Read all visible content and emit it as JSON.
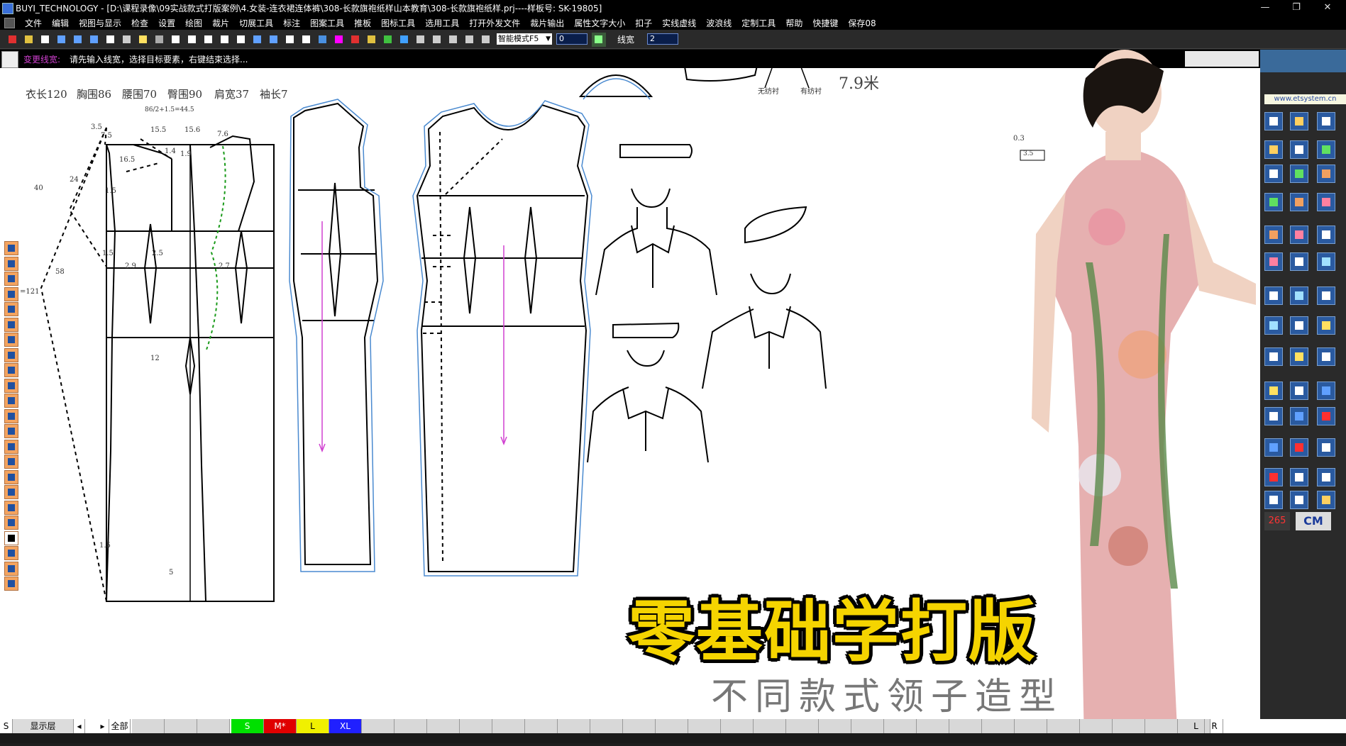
{
  "window": {
    "title": "BUYI_TECHNOLOGY - [D:\\课程录像\\09实战款式打版案例\\4.女装-连衣裙连体裤\\308-长款旗袍纸样山本教育\\308-长款旗袍纸样.prj----样板号: SK-19805]",
    "controls": [
      "—",
      "❐",
      "✕"
    ]
  },
  "menu": [
    "文件",
    "编辑",
    "视图与显示",
    "检查",
    "设置",
    "绘图",
    "裁片",
    "切展工具",
    "标注",
    "图案工具",
    "推板",
    "图标工具",
    "选用工具",
    "打开外发文件",
    "裁片输出",
    "属性文字大小",
    "扣子",
    "实线虚线",
    "波浪线",
    "定制工具",
    "帮助",
    "快捷键",
    "保存08"
  ],
  "toolbar": {
    "mode_select": "智能模式F5",
    "value_input": "0",
    "line_width_label": "线宽",
    "line_width_input": "2",
    "settings_label": "设"
  },
  "prompt": {
    "label": "变更线宽:",
    "text": "请先输入线宽，选择目标要素，右键结束选择..."
  },
  "measurements": {
    "length": "衣长120",
    "bust": "胸围86",
    "waist": "腰围70",
    "hip": "臀围90",
    "shoulder": "肩宽37",
    "sleeve": "袖长7",
    "formula": "86/2+1.5=44.5",
    "fabric": "7.9米"
  },
  "pattern_labels": {
    "a1": "3.5",
    "a2": "7.5",
    "a3": "15.5",
    "a4": "15.6",
    "a5": "7.6",
    "a6": "1.4",
    "a7": "1.9",
    "a8": "16.5",
    "a9": "40",
    "a10": "24",
    "a11": "1.5",
    "a12": "58",
    "a13": "=121",
    "a14": "1.5",
    "a15": "2.5",
    "a16": "2.9",
    "a17": "2.7",
    "a18": "12",
    "a19": "1.5",
    "a20": "5",
    "a21": "0.3",
    "a22": "3.5",
    "a23": "无纺衬",
    "a24": "有纺衬"
  },
  "overlay": {
    "title": "零基础学打版",
    "subtitle": "不同款式领子造型"
  },
  "right_panel": {
    "url": "www.etsystem.cn",
    "counter": "265",
    "unit": "CM"
  },
  "status": {
    "s": "S",
    "layer": "显示层",
    "all": "全部",
    "sizes": [
      {
        "label": "S",
        "color": "#00e000"
      },
      {
        "label": "M*",
        "color": "#e00000"
      },
      {
        "label": "L",
        "color": "#f0f000"
      },
      {
        "label": "XL",
        "color": "#2020ff"
      }
    ],
    "l": "L",
    "r": "R"
  }
}
